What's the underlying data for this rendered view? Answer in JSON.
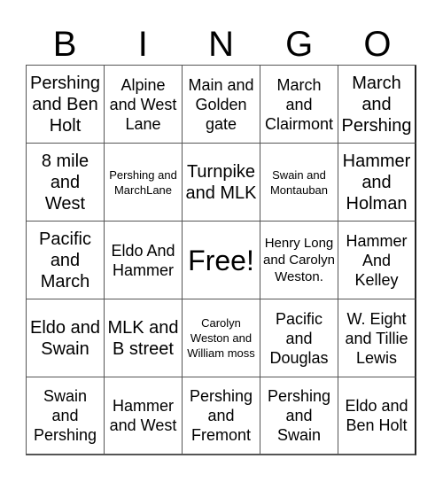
{
  "header": {
    "letters": [
      "B",
      "I",
      "N",
      "G",
      "O"
    ]
  },
  "cells": [
    {
      "text": "Pershing and Ben Holt",
      "size": "s-l"
    },
    {
      "text": "Alpine and West Lane",
      "size": "s-m"
    },
    {
      "text": "Main and Golden gate",
      "size": "s-m"
    },
    {
      "text": "March and Clairmont",
      "size": "s-m"
    },
    {
      "text": "March and Pershing",
      "size": "s-l"
    },
    {
      "text": "8 mile and West",
      "size": "s-l"
    },
    {
      "text": "Pershing and MarchLane",
      "size": "s-xs"
    },
    {
      "text": "Turnpike and MLK",
      "size": "s-l"
    },
    {
      "text": "Swain and Montauban",
      "size": "s-xs"
    },
    {
      "text": "Hammer and Holman",
      "size": "s-l"
    },
    {
      "text": "Pacific and March",
      "size": "s-l"
    },
    {
      "text": "Eldo And Hammer",
      "size": "s-m"
    },
    {
      "text": "Free!",
      "size": "s-xl"
    },
    {
      "text": "Henry Long and Carolyn Weston.",
      "size": "s-s"
    },
    {
      "text": "Hammer And Kelley",
      "size": "s-m"
    },
    {
      "text": "Eldo and Swain",
      "size": "s-l"
    },
    {
      "text": "MLK and B street",
      "size": "s-l"
    },
    {
      "text": "Carolyn Weston and William moss",
      "size": "s-xs"
    },
    {
      "text": "Pacific and Douglas",
      "size": "s-m"
    },
    {
      "text": "W. Eight and Tillie Lewis",
      "size": "s-m"
    },
    {
      "text": "Swain and Pershing",
      "size": "s-m"
    },
    {
      "text": "Hammer and West",
      "size": "s-m"
    },
    {
      "text": "Pershing and Fremont",
      "size": "s-m"
    },
    {
      "text": "Pershing and Swain",
      "size": "s-m"
    },
    {
      "text": "Eldo and Ben Holt",
      "size": "s-m"
    }
  ]
}
